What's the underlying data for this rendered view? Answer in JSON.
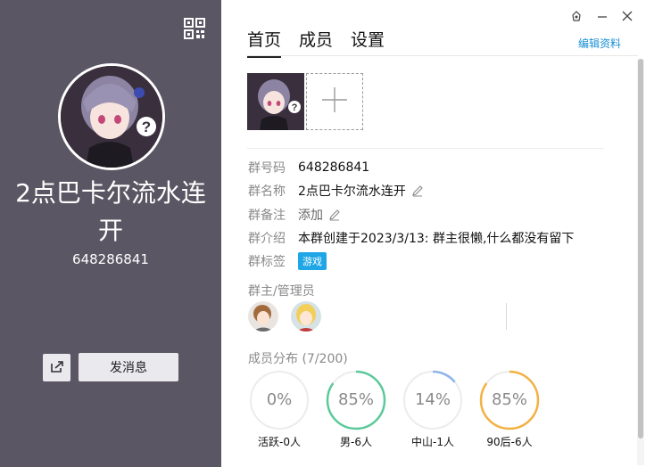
{
  "profile": {
    "group_name": "2点巴卡尔流水连开",
    "group_number": "648286841",
    "send_message_label": "发消息"
  },
  "window": {
    "controls": [
      "skin-icon",
      "minimize-icon",
      "close-icon"
    ]
  },
  "tabs": [
    {
      "label": "首页",
      "active": true
    },
    {
      "label": "成员",
      "active": false
    },
    {
      "label": "设置",
      "active": false
    }
  ],
  "edit_profile_label": "编辑资料",
  "info": {
    "number_label": "群号码",
    "number_value": "648286841",
    "name_label": "群名称",
    "name_value": "2点巴卡尔流水连开",
    "remark_label": "群备注",
    "remark_value": "添加",
    "intro_label": "群介绍",
    "intro_value": "本群创建于2023/3/13:  群主很懒,什么都没有留下",
    "tag_label": "群标签",
    "tag_value": "游戏"
  },
  "admins": {
    "title": "群主/管理员",
    "count": 2
  },
  "members": {
    "title": "成员分布 (7/200)",
    "stats": [
      {
        "percent": "0%",
        "value": 0,
        "label": "活跃-0人",
        "color": "#e8e8e8"
      },
      {
        "percent": "85%",
        "value": 85,
        "label": "男-6人",
        "color": "#5cc99b"
      },
      {
        "percent": "14%",
        "value": 14,
        "label": "中山-1人",
        "color": "#8fb4ea"
      },
      {
        "percent": "85%",
        "value": 85,
        "label": "90后-6人",
        "color": "#f2b143"
      }
    ]
  },
  "colors": {
    "left_panel": "#5b5663",
    "accent_link": "#1a8fd6",
    "tag_bg": "#1ea6e6"
  }
}
